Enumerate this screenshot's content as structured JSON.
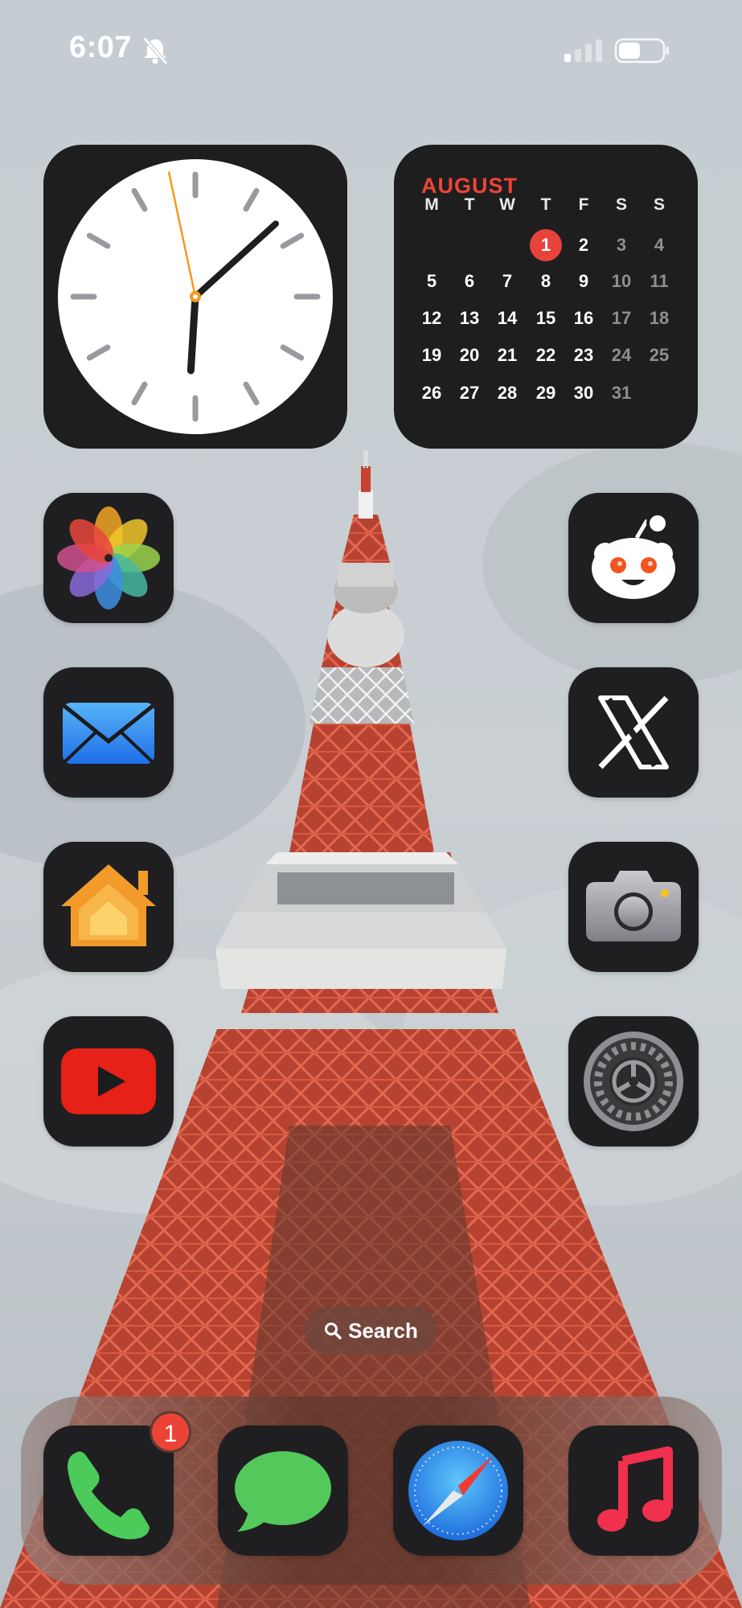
{
  "status_bar": {
    "time": "6:07",
    "icons": [
      "bell-slash-icon",
      "cellular-signal-icon",
      "battery-icon"
    ]
  },
  "calendar_widget": {
    "month": "AUGUST",
    "weekday_headers": [
      "M",
      "T",
      "W",
      "T",
      "F",
      "S",
      "S"
    ],
    "weeks": [
      [
        "",
        "",
        "",
        "1",
        "2",
        "3",
        "4"
      ],
      [
        "5",
        "6",
        "7",
        "8",
        "9",
        "10",
        "11"
      ],
      [
        "12",
        "13",
        "14",
        "15",
        "16",
        "17",
        "18"
      ],
      [
        "19",
        "20",
        "21",
        "22",
        "23",
        "24",
        "25"
      ],
      [
        "26",
        "27",
        "28",
        "29",
        "30",
        "31",
        ""
      ]
    ],
    "today": "1",
    "accent_color": "#e8433a"
  },
  "clock_widget": {
    "hour": 6,
    "minute": 7,
    "second": 58
  },
  "apps": {
    "left_column": [
      "photos-icon",
      "mail-icon",
      "home-icon",
      "youtube-icon"
    ],
    "right_column": [
      "reddit-icon",
      "x-icon",
      "camera-icon",
      "settings-icon"
    ]
  },
  "search": {
    "label": "Search",
    "icon": "search-icon"
  },
  "dock": {
    "apps": [
      "phone-icon",
      "messages-icon",
      "safari-icon",
      "music-icon"
    ],
    "phone_badge": "1"
  }
}
